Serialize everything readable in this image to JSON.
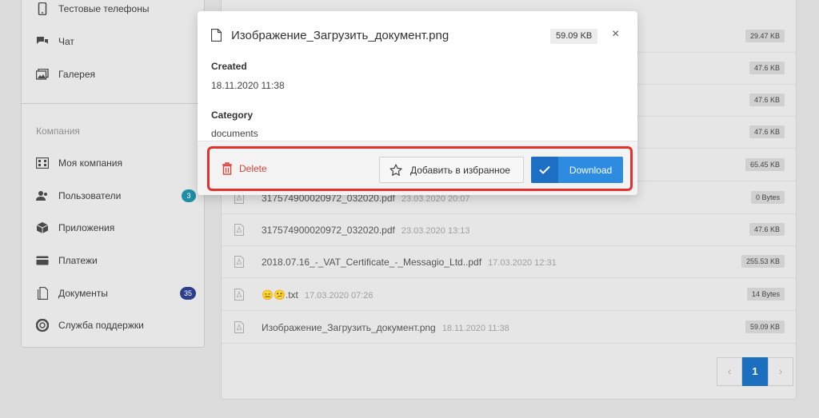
{
  "sidebar": {
    "items": [
      {
        "label": "Тестовые телефоны",
        "icon": "phone-icon"
      },
      {
        "label": "Чат",
        "icon": "chat-icon"
      },
      {
        "label": "Галерея",
        "icon": "gallery-icon"
      }
    ],
    "section_label": "Компания",
    "company_items": [
      {
        "label": "Моя компания",
        "icon": "company-icon"
      },
      {
        "label": "Пользователи",
        "icon": "users-icon",
        "badge": "3",
        "badge_color": "#1e8fa6"
      },
      {
        "label": "Приложения",
        "icon": "apps-icon"
      },
      {
        "label": "Платежи",
        "icon": "payments-icon"
      },
      {
        "label": "Документы",
        "icon": "documents-icon",
        "badge": "35",
        "badge_color": "#2c3e8c"
      },
      {
        "label": "Служба поддержки",
        "icon": "support-icon"
      }
    ]
  },
  "files": [
    {
      "name": "",
      "date": "",
      "size": "29.47 KB"
    },
    {
      "name": "",
      "date": "",
      "size": "47.6 KB"
    },
    {
      "name": "",
      "date": "",
      "size": "47.6 KB"
    },
    {
      "name": "",
      "date": "",
      "size": "47.6 KB"
    },
    {
      "name": "",
      "date": "",
      "size": "65.45 KB"
    },
    {
      "name": "317574900020972_032020.pdf",
      "date": "23.03.2020 20:07",
      "size": "0 Bytes"
    },
    {
      "name": "317574900020972_032020.pdf",
      "date": "23.03.2020 13:13",
      "size": "47.6 KB"
    },
    {
      "name": "2018.07.16_-_VAT_Certificate_-_Messagio_Ltd..pdf",
      "date": "17.03.2020 12:31",
      "size": "255.53 KB"
    },
    {
      "name": "😑😕.txt",
      "date": "17.03.2020 07:26",
      "size": "14 Bytes"
    },
    {
      "name": "Изображение_Загрузить_документ.png",
      "date": "18.11.2020 11:38",
      "size": "59.09 KB"
    }
  ],
  "pagination": {
    "prev": "‹",
    "current": "1",
    "next": "›"
  },
  "modal": {
    "title": "Изображение_Загрузить_документ.png",
    "size": "59.09 KB",
    "close": "×",
    "created_label": "Created",
    "created_value": "18.11.2020 11:38",
    "category_label": "Category",
    "category_value": "documents",
    "delete_label": "Delete",
    "favorite_label": "Добавить в избранное",
    "download_label": "Download"
  },
  "colors": {
    "accent": "#2d8be0",
    "danger": "#d9433a",
    "highlight": "#e3312d"
  }
}
